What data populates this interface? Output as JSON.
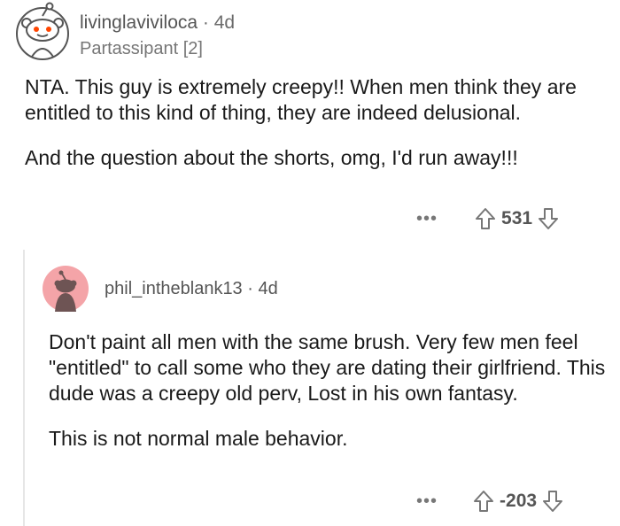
{
  "comment": {
    "username": "livinglaviviloca",
    "separator": "·",
    "age": "4d",
    "flair": "Partassipant [2]",
    "paragraphs": [
      "NTA. This guy is extremely creepy!! When men think they are entitled to this kind of thing, they are indeed delusional.",
      "And the question about the shorts, omg, I'd run away!!!"
    ],
    "more_label": "•••",
    "score": "531",
    "avatar_icon": "snoo-avatar-icon"
  },
  "reply": {
    "username": "phil_intheblank13",
    "separator": "·",
    "age": "4d",
    "paragraphs": [
      "Don't paint all men with the same brush. Very few men feel \"entitled\" to call some who they are dating their girlfriend. This dude was a creepy old perv, Lost in his own fantasy.",
      "This is not normal male behavior."
    ],
    "more_label": "•••",
    "score": "-203",
    "avatar_color": "#f4a4a8",
    "avatar_icon": "snoo-avatar-icon"
  },
  "icons": {
    "upvote": "upvote-arrow-icon",
    "downvote": "downvote-arrow-icon"
  }
}
